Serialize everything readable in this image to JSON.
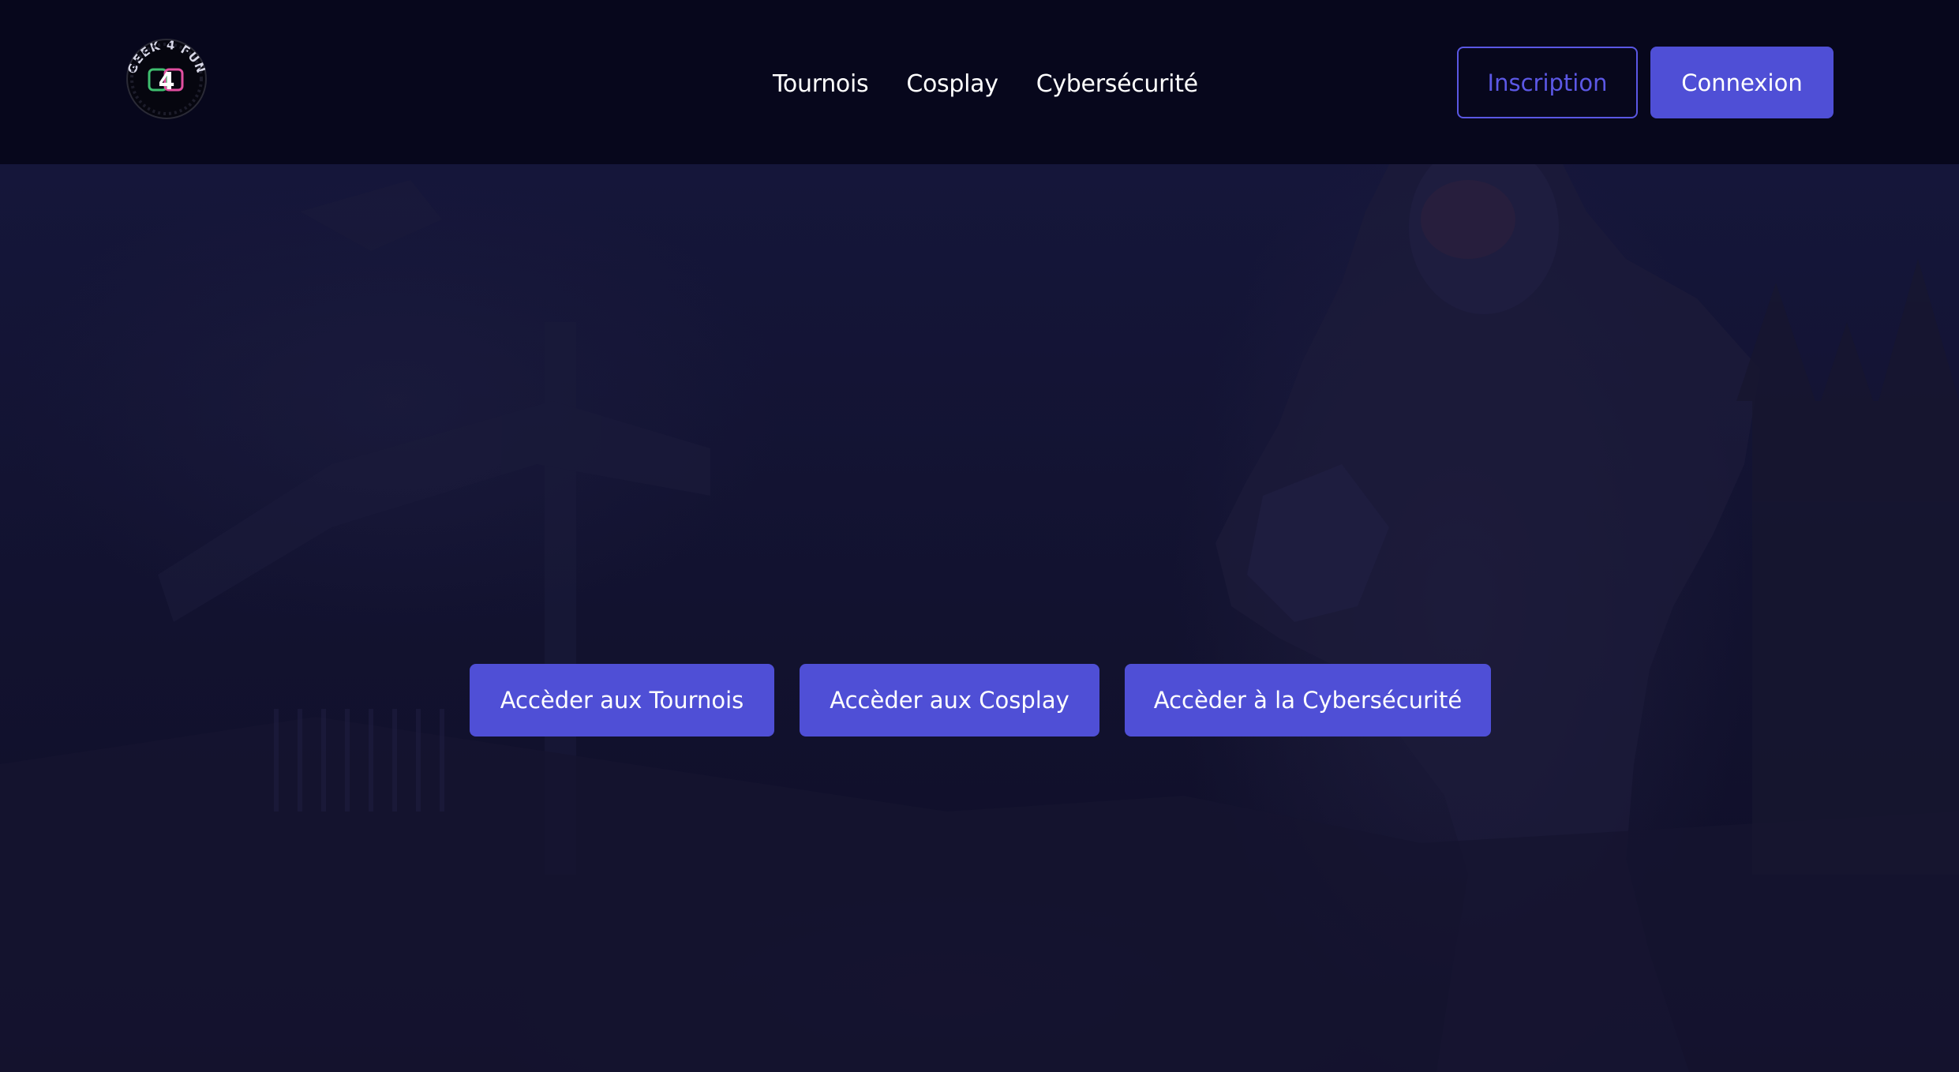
{
  "header": {
    "logo": {
      "icon": "geek-4-fun-logo-icon",
      "text": "GEEK 4 FUN",
      "center": "4"
    },
    "nav": [
      {
        "label": "Tournois"
      },
      {
        "label": "Cosplay"
      },
      {
        "label": "Cybersécurité"
      }
    ],
    "signup_label": "Inscription",
    "login_label": "Connexion"
  },
  "hero": {
    "buttons": [
      {
        "label": "Accèder aux Tournois"
      },
      {
        "label": "Accèder aux Cosplay"
      },
      {
        "label": "Accèder à la Cybersécurité"
      }
    ]
  },
  "colors": {
    "header_bg": "#07071c",
    "accent": "#4f4fd6",
    "outline_text": "#5c58e6",
    "hero_bg": "#13132f"
  }
}
